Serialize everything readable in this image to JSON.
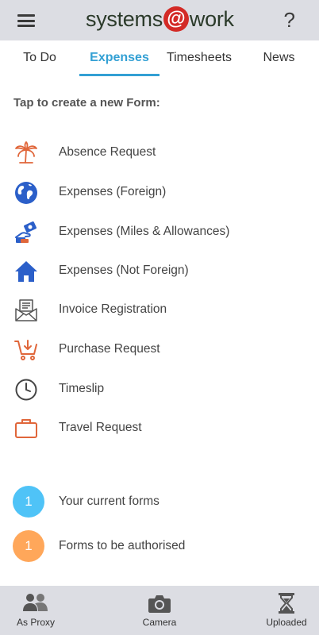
{
  "header": {
    "logo_left": "systems",
    "logo_at": "@",
    "logo_right": "work",
    "help_label": "?"
  },
  "tabs": [
    {
      "label": "To Do",
      "active": false
    },
    {
      "label": "Expenses",
      "active": true
    },
    {
      "label": "Timesheets",
      "active": false
    },
    {
      "label": "News",
      "active": false
    }
  ],
  "main": {
    "prompt": "Tap to create a new Form:",
    "forms": [
      {
        "label": "Absence Request",
        "icon": "palm-tree-icon"
      },
      {
        "label": "Expenses (Foreign)",
        "icon": "globe-icon"
      },
      {
        "label": "Expenses (Miles & Allowances)",
        "icon": "hand-money-icon"
      },
      {
        "label": "Expenses (Not Foreign)",
        "icon": "home-icon"
      },
      {
        "label": "Invoice Registration",
        "icon": "invoice-envelope-icon"
      },
      {
        "label": "Purchase Request",
        "icon": "cart-icon"
      },
      {
        "label": "Timeslip",
        "icon": "clock-icon"
      },
      {
        "label": "Travel Request",
        "icon": "briefcase-icon"
      }
    ],
    "counts": [
      {
        "count": "1",
        "label": "Your current forms",
        "color": "#4fc3f7"
      },
      {
        "count": "1",
        "label": "Forms to be authorised",
        "color": "#ffa75a"
      }
    ]
  },
  "bottom_bar": {
    "items": [
      {
        "label": "As Proxy",
        "icon": "people-icon"
      },
      {
        "label": "Camera",
        "icon": "camera-icon"
      },
      {
        "label": "Uploaded",
        "icon": "hourglass-icon"
      }
    ]
  },
  "colors": {
    "accent": "#33a0d4",
    "header_bg": "#dcdde3",
    "logo_red": "#d32a26",
    "icon_orange": "#e0663a",
    "icon_blue": "#2b5fc9"
  }
}
